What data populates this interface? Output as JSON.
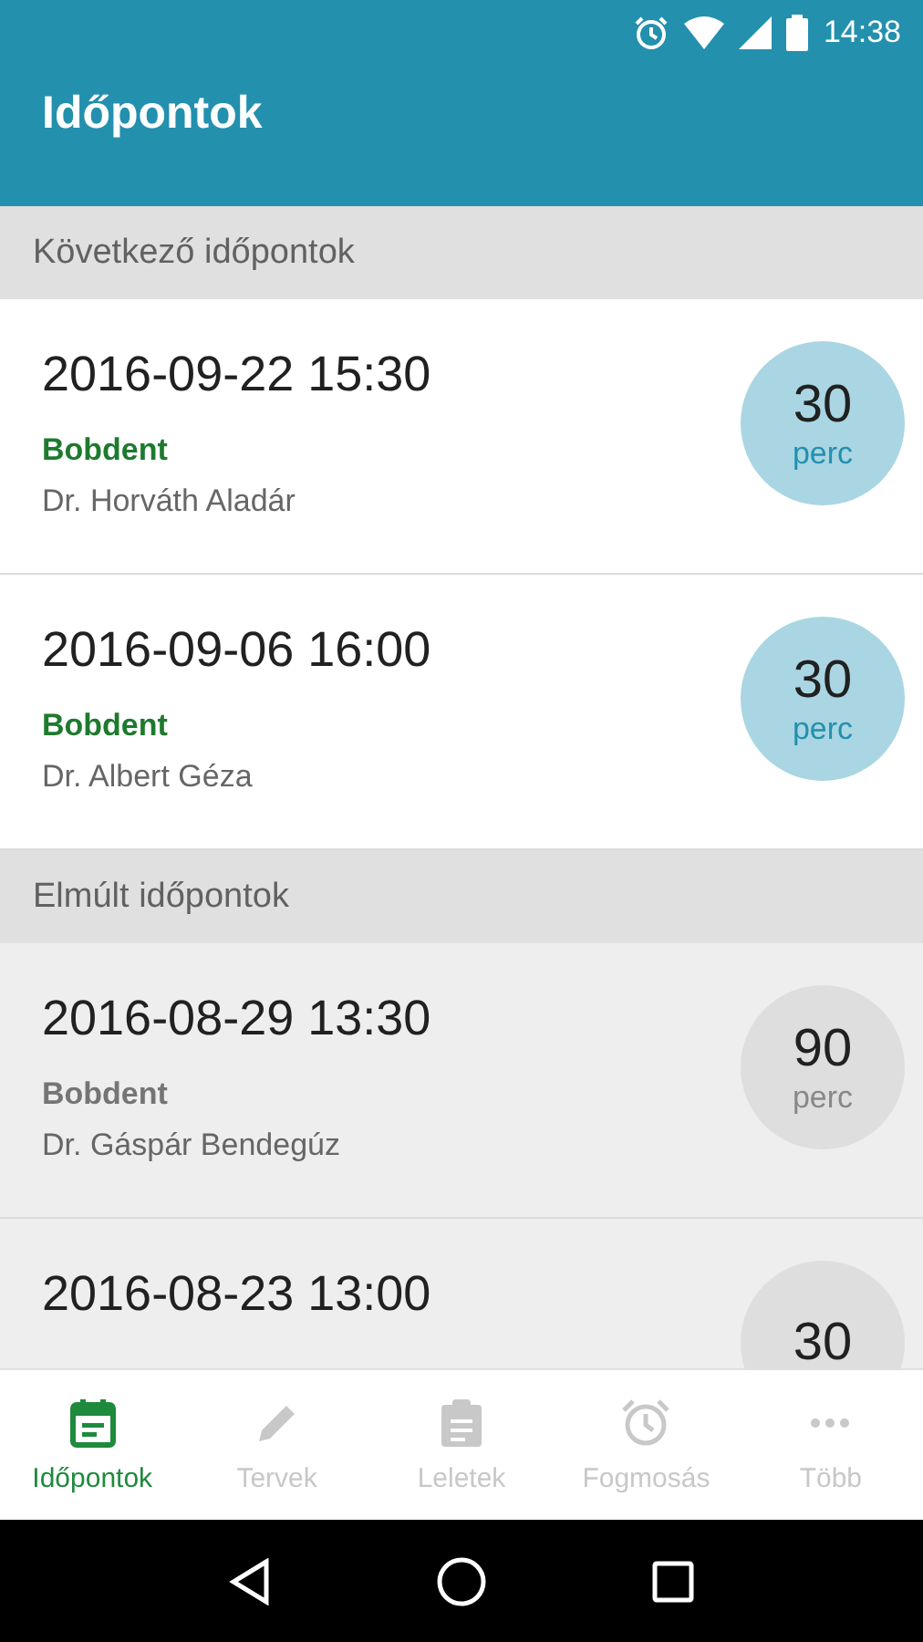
{
  "status_bar": {
    "time": "14:38"
  },
  "app_bar": {
    "title": "Időpontok"
  },
  "sections": [
    {
      "title": "Következő időpontok",
      "kind": "upcoming",
      "appointments": [
        {
          "datetime": "2016-09-22 15:30",
          "clinic": "Bobdent",
          "doctor": "Dr. Horváth Aladár",
          "minutes": "30",
          "unit": "perc"
        },
        {
          "datetime": "2016-09-06 16:00",
          "clinic": "Bobdent",
          "doctor": "Dr. Albert Géza",
          "minutes": "30",
          "unit": "perc"
        }
      ]
    },
    {
      "title": "Elmúlt időpontok",
      "kind": "past",
      "appointments": [
        {
          "datetime": "2016-08-29 13:30",
          "clinic": "Bobdent",
          "doctor": "Dr. Gáspár Bendegúz",
          "minutes": "90",
          "unit": "perc"
        },
        {
          "datetime": "2016-08-23 13:00",
          "minutes": "30"
        }
      ]
    }
  ],
  "bottom_nav": [
    {
      "label": "Időpontok",
      "kind": "calendar",
      "selected": true
    },
    {
      "label": "Tervek",
      "kind": "pencil",
      "selected": false
    },
    {
      "label": "Leletek",
      "kind": "clipboard",
      "selected": false
    },
    {
      "label": "Fogmosás",
      "kind": "alarm",
      "selected": false
    },
    {
      "label": "Több",
      "kind": "more",
      "selected": false
    }
  ]
}
